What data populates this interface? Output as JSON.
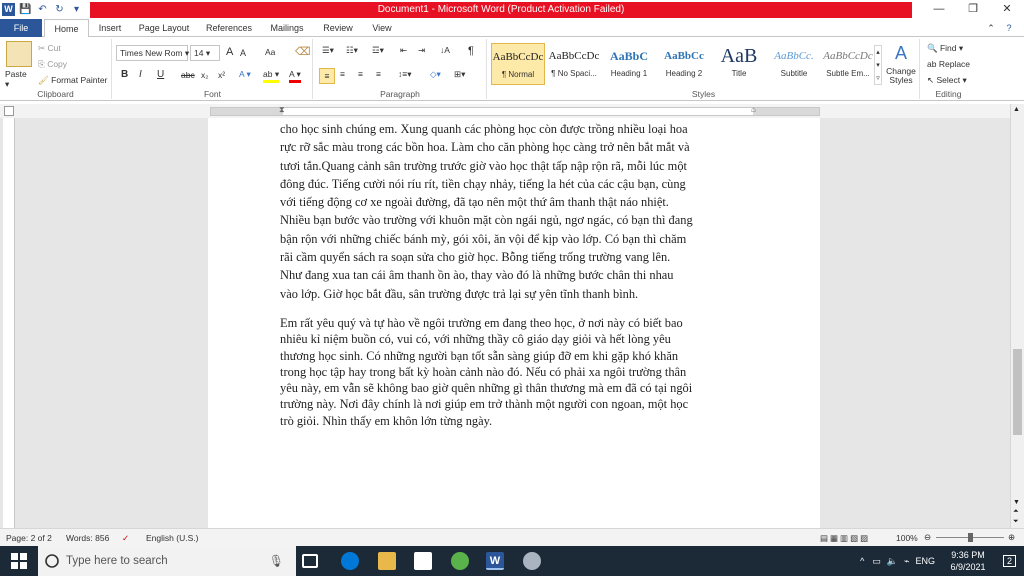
{
  "titlebar": {
    "title": "Document1 - Microsoft Word (Product Activation Failed)",
    "minimize": "—",
    "restore": "❐",
    "close": "✕"
  },
  "tabs": [
    {
      "label": "File"
    },
    {
      "label": "Home"
    },
    {
      "label": "Insert"
    },
    {
      "label": "Page Layout"
    },
    {
      "label": "References"
    },
    {
      "label": "Mailings"
    },
    {
      "label": "Review"
    },
    {
      "label": "View"
    }
  ],
  "clipboard": {
    "group_label": "Clipboard",
    "paste": "Paste",
    "cut": "Cut",
    "copy": "Copy",
    "format_painter": "Format Painter"
  },
  "font": {
    "group_label": "Font",
    "font_name": "Times New Rom",
    "font_size": "14",
    "grow": "A",
    "shrink": "A",
    "change_case": "Aa",
    "bold": "B",
    "italic": "I",
    "underline": "U",
    "strike": "abc",
    "subscript": "x₂",
    "superscript": "x²"
  },
  "paragraph": {
    "group_label": "Paragraph"
  },
  "styles": {
    "group_label": "Styles",
    "items": [
      {
        "sample": "AaBbCcDc",
        "name": "¶ Normal"
      },
      {
        "sample": "AaBbCcDc",
        "name": "¶ No Spaci..."
      },
      {
        "sample": "AaBbC",
        "name": "Heading 1"
      },
      {
        "sample": "AaBbCc",
        "name": "Heading 2"
      },
      {
        "sample": "AaB",
        "name": "Title"
      },
      {
        "sample": "AaBbCc.",
        "name": "Subtitle"
      },
      {
        "sample": "AaBbCcDc",
        "name": "Subtle Em..."
      }
    ],
    "change_styles": "Change Styles"
  },
  "editing": {
    "group_label": "Editing",
    "find": "Find",
    "replace": "Replace",
    "select": "Select"
  },
  "document": {
    "para1_lines": [
      "cho học sinh chúng em. Xung quanh các phòng học còn được trồng nhiều loại hoa",
      "rực rỡ sắc màu trong các bồn hoa. Làm cho căn phòng học càng trở nên bắt mắt và",
      "tươi tắn.Quang cảnh sân trường trước giờ vào học thật tấp nập rộn rã, mỗi lúc một",
      "đông đúc. Tiếng cười nói ríu rít, tiền chạy nhảy, tiếng la hét của các cậu bạn, cùng",
      "với tiếng động cơ xe ngoài đường, đã tạo nên một thứ âm thanh thật náo nhiệt.",
      "Nhiều bạn bước vào trường với khuôn mặt còn ngái ngủ, ngơ ngác, có bạn thì đang",
      "bận rộn với những chiếc bánh mỳ, gói xôi, ăn vội để kịp vào lớp. Có bạn thì chăm",
      "rãi cầm quyển sách ra soạn sửa cho giờ học. Bỗng tiếng trống trường vang lên.",
      "Như đang xua tan cái âm thanh ồn ào, thay vào đó là những bước chân thi nhau",
      "vào lớp. Giờ học bắt đầu, sân trường được trả lại sự yên tĩnh thanh bình."
    ],
    "para2_lines": [
      "Em rất yêu quý và tự hào về ngôi trường em đang theo học, ở nơi này có biết bao",
      "nhiêu kỉ niệm buồn có, vui có, với những thầy cô giáo dạy giỏi và hết lòng yêu",
      "thương học sinh. Có những người bạn tốt sẵn sàng giúp đỡ em khi gặp khó khăn",
      "trong học tập hay trong bất kỳ hoàn cảnh nào đó. Nếu có phải xa ngôi trường thân",
      "yêu này, em vẫn sẽ không bao giờ quên những gì thân thương mà em đã có tại ngôi",
      "trường này. Nơi đây chính là nơi giúp em trở thành một người con ngoan, một học",
      "trò giỏi. Nhìn thấy em khôn lớn từng ngày."
    ]
  },
  "statusbar": {
    "page": "Page: 2 of 2",
    "words": "Words: 856",
    "language": "English (U.S.)",
    "zoom": "100%",
    "zoom_level": 1.0
  },
  "taskbar": {
    "search_placeholder": "Type here to search",
    "language": "ENG",
    "time": "9:36 PM",
    "date": "6/9/2021",
    "notifications": "2"
  },
  "colors": {
    "title_bar_alert": "#e81123",
    "file_tab": "#2b579a",
    "taskbar": "#1c2a38"
  }
}
